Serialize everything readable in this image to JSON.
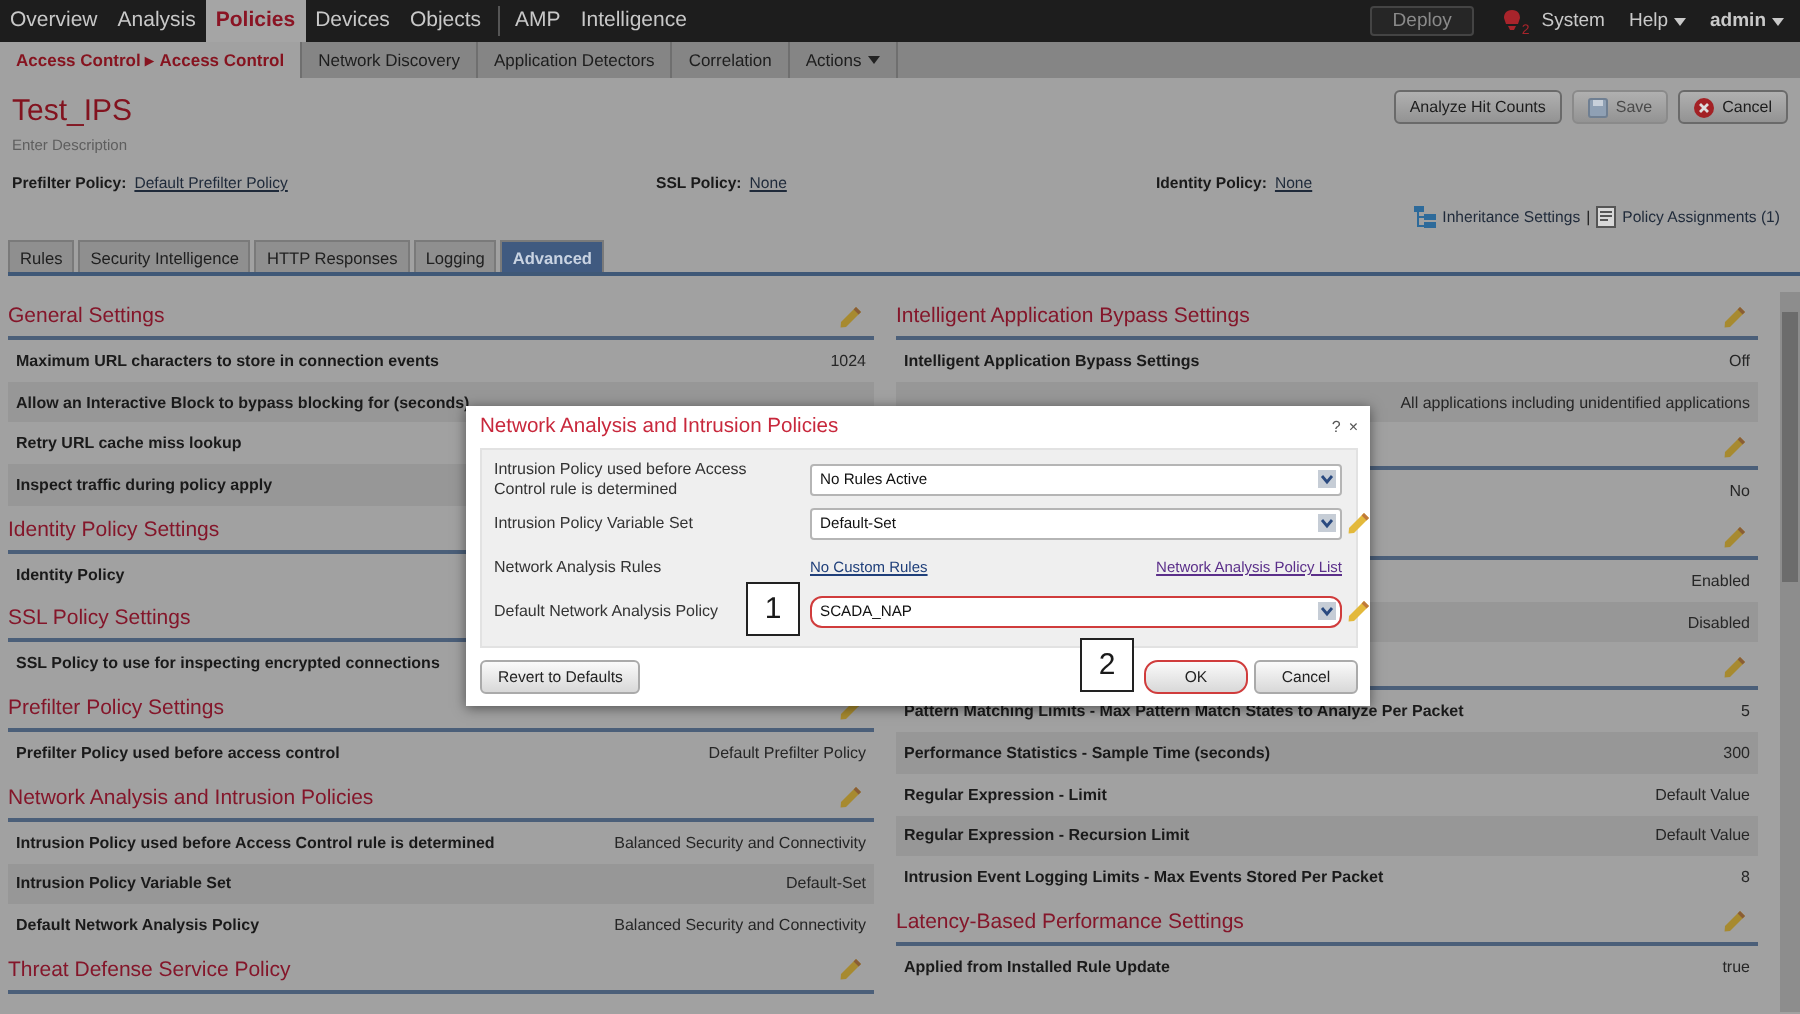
{
  "top_nav": {
    "groups": [
      [
        {
          "label": "Overview",
          "selected": false
        },
        {
          "label": "Analysis",
          "selected": false
        },
        {
          "label": "Policies",
          "selected": true
        },
        {
          "label": "Devices",
          "selected": false
        },
        {
          "label": "Objects",
          "selected": false
        }
      ],
      [
        {
          "label": "AMP",
          "selected": false
        },
        {
          "label": "Intelligence",
          "selected": false
        }
      ]
    ],
    "deploy": "Deploy",
    "alert_count": "2",
    "links": [
      {
        "label": "System",
        "kind": "link"
      },
      {
        "label": "Help",
        "kind": "menu"
      },
      {
        "label": "admin",
        "kind": "menu"
      }
    ]
  },
  "sub_nav": [
    {
      "label": "Access Control ▸ Access Control",
      "selected": true,
      "kind": "link"
    },
    {
      "label": "Network Discovery",
      "selected": false,
      "kind": "link"
    },
    {
      "label": "Application Detectors",
      "selected": false,
      "kind": "link"
    },
    {
      "label": "Correlation",
      "selected": false,
      "kind": "link"
    },
    {
      "label": "Actions",
      "selected": false,
      "kind": "menu"
    }
  ],
  "policy": {
    "title": "Test_IPS",
    "description_placeholder": "Enter Description",
    "buttons": [
      {
        "label": "Analyze Hit Counts",
        "kind": "plain",
        "disabled": false
      },
      {
        "label": "Save",
        "kind": "save",
        "disabled": true
      },
      {
        "label": "Cancel",
        "kind": "cancel",
        "disabled": false
      }
    ],
    "assignments": [
      {
        "label": "Prefilter Policy:",
        "value": "Default Prefilter Policy"
      },
      {
        "label": "SSL Policy:",
        "value": "None"
      },
      {
        "label": "Identity Policy:",
        "value": "None"
      }
    ],
    "inheritance": "Inheritance Settings",
    "separator": "|",
    "policy_assignments": "Policy Assignments (1)"
  },
  "tabs": [
    {
      "label": "Rules",
      "selected": false
    },
    {
      "label": "Security Intelligence",
      "selected": false
    },
    {
      "label": "HTTP Responses",
      "selected": false
    },
    {
      "label": "Logging",
      "selected": false
    },
    {
      "label": "Advanced",
      "selected": true
    }
  ],
  "left_sections": [
    {
      "title": "General Settings",
      "rows": [
        {
          "label": "Maximum URL characters to store in connection events",
          "value": "1024"
        },
        {
          "label": "Allow an Interactive Block to bypass blocking for (seconds)"
        },
        {
          "label": "Retry URL cache miss lookup"
        },
        {
          "label": "Inspect traffic during policy apply"
        }
      ]
    },
    {
      "title": "Identity Policy Settings",
      "rows": [
        {
          "label": "Identity Policy"
        }
      ]
    },
    {
      "title": "SSL Policy Settings",
      "rows": [
        {
          "label": "SSL Policy to use for inspecting encrypted connections"
        }
      ]
    },
    {
      "title": "Prefilter Policy Settings",
      "rows": [
        {
          "label": "Prefilter Policy used before access control",
          "value": "Default Prefilter Policy"
        }
      ]
    },
    {
      "title": "Network Analysis and Intrusion Policies",
      "rows": [
        {
          "label": "Intrusion Policy used before Access Control rule is determined",
          "value": "Balanced Security and Connectivity"
        },
        {
          "label": "Intrusion Policy Variable Set",
          "value": "Default-Set"
        },
        {
          "label": "Default Network Analysis Policy",
          "value": "Balanced Security and Connectivity"
        }
      ]
    },
    {
      "title": "Threat Defense Service Policy"
    }
  ],
  "right_sections": [
    {
      "title": "Intelligent Application Bypass Settings",
      "rows": [
        {
          "label": "Intelligent Application Bypass Settings",
          "value": "Off"
        },
        {
          "value": "All applications including unidentified applications"
        }
      ]
    },
    {
      "rows": [
        {
          "value": "No"
        }
      ]
    },
    {
      "rows": [
        {
          "value": "Enabled"
        },
        {
          "value": "Disabled"
        }
      ]
    },
    {
      "rows": [
        {
          "label": "Pattern Matching Limits - Max Pattern Match States to Analyze Per Packet",
          "value": "5"
        },
        {
          "label": "Performance Statistics - Sample Time (seconds)",
          "value": "300"
        },
        {
          "label": "Regular Expression - Limit",
          "value": "Default Value"
        },
        {
          "label": "Regular Expression - Recursion Limit",
          "value": "Default Value"
        },
        {
          "label": "Intrusion Event Logging Limits - Max Events Stored Per Packet",
          "value": "8"
        }
      ]
    },
    {
      "title": "Latency-Based Performance Settings",
      "rows": [
        {
          "label": "Applied from Installed Rule Update",
          "value": "true"
        }
      ]
    }
  ],
  "dialog": {
    "title": "Network Analysis and Intrusion Policies",
    "help": "?",
    "close": "×",
    "rows": [
      {
        "kind": "select",
        "label": "Intrusion Policy used before Access Control rule is determined",
        "value": "No Rules Active",
        "editable": false,
        "highlighted": false
      },
      {
        "kind": "select",
        "label": "Intrusion Policy Variable Set",
        "value": "Default-Set",
        "editable": true,
        "highlighted": false
      },
      {
        "kind": "links",
        "label": "Network Analysis Rules",
        "links": [
          "No Custom Rules",
          "Network Analysis Policy List"
        ]
      },
      {
        "kind": "select",
        "label": "Default Network Analysis Policy",
        "value": "SCADA_NAP",
        "editable": true,
        "highlighted": true,
        "marker": "1"
      }
    ],
    "revert": "Revert to Defaults",
    "buttons": [
      {
        "label": "OK",
        "highlighted": true,
        "marker": "2"
      },
      {
        "label": "Cancel",
        "highlighted": false
      }
    ]
  }
}
